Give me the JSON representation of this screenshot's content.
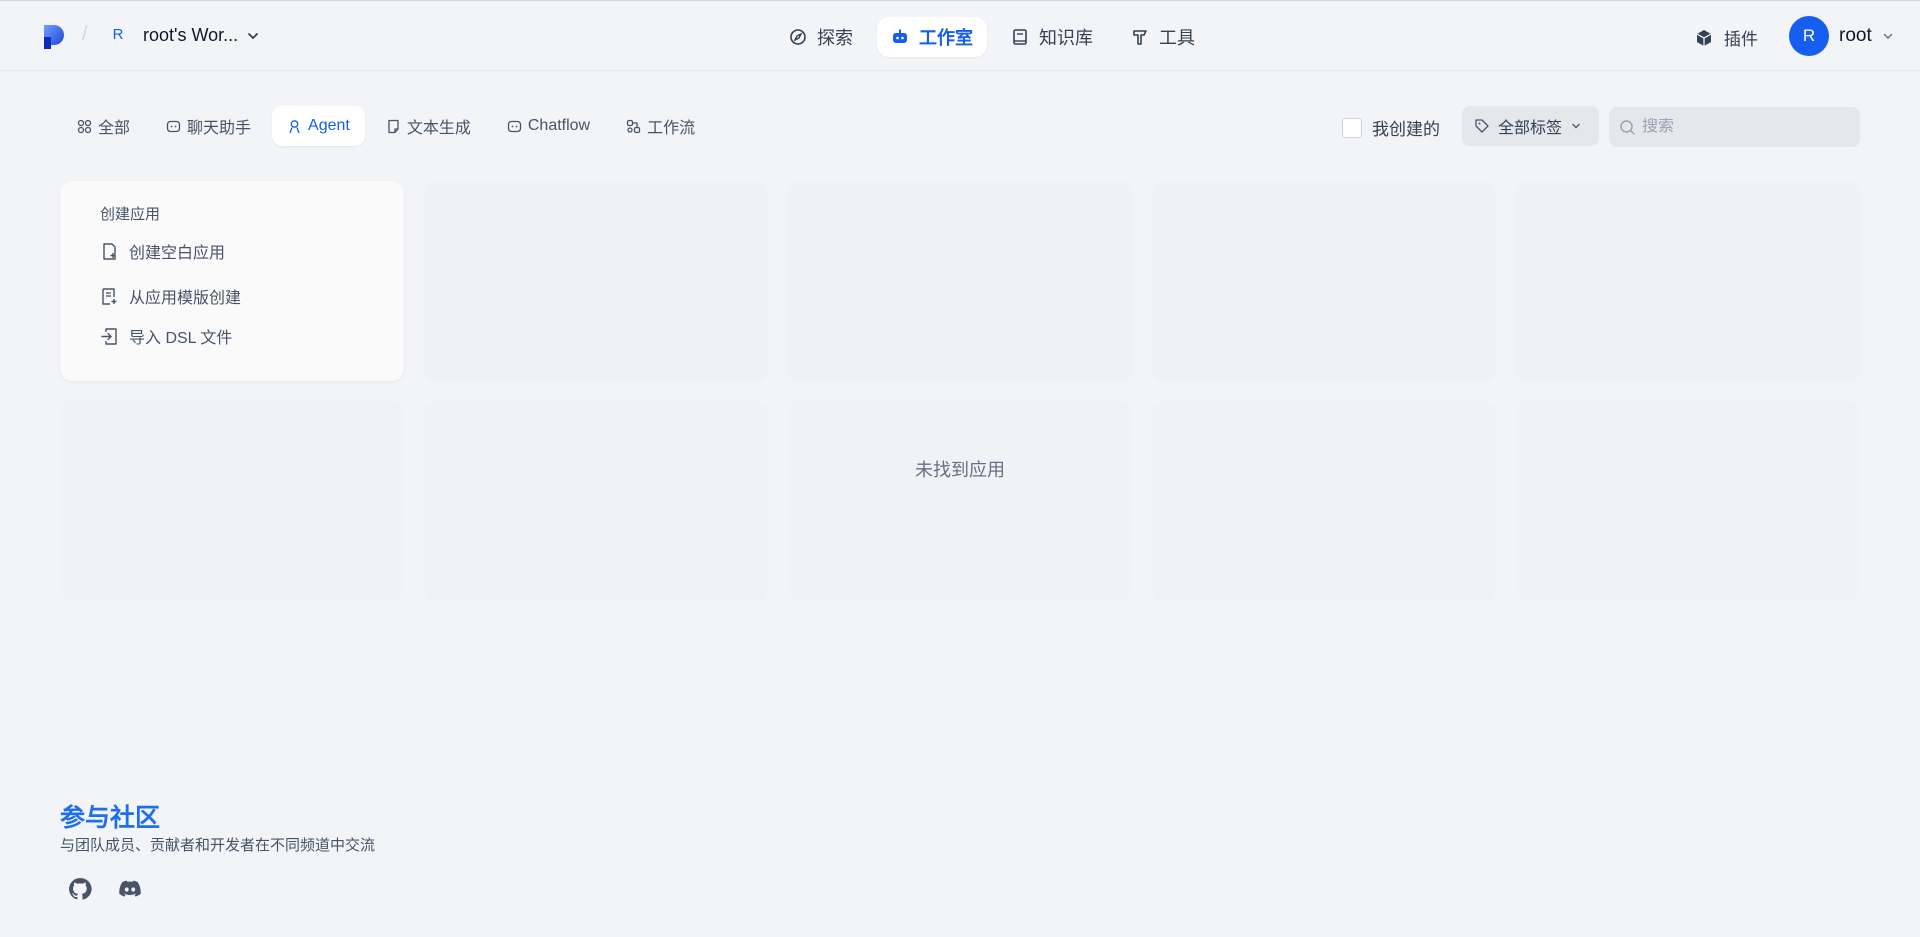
{
  "header": {
    "workspace_initial": "R",
    "workspace_name": "root's Wor...",
    "separator": "/",
    "nav": [
      {
        "label": "探索",
        "icon": "compass-icon"
      },
      {
        "label": "工作室",
        "icon": "robot-icon",
        "active": true
      },
      {
        "label": "知识库",
        "icon": "book-icon"
      },
      {
        "label": "工具",
        "icon": "hammer-icon"
      }
    ],
    "plugin_label": "插件",
    "user_initial": "R",
    "user_name": "root"
  },
  "tabs": [
    {
      "label": "全部",
      "icon": "grid-icon"
    },
    {
      "label": "聊天助手",
      "icon": "chat-bot-icon"
    },
    {
      "label": "Agent",
      "icon": "agent-icon",
      "active": true
    },
    {
      "label": "文本生成",
      "icon": "document-icon"
    },
    {
      "label": "Chatflow",
      "icon": "chatflow-icon"
    },
    {
      "label": "工作流",
      "icon": "workflow-icon"
    }
  ],
  "filters": {
    "mine_label": "我创建的",
    "tag_label": "全部标签",
    "search_placeholder": "搜索"
  },
  "create_card": {
    "title": "创建应用",
    "items": [
      {
        "label": "创建空白应用",
        "icon": "file-plus-icon"
      },
      {
        "label": "从应用模版创建",
        "icon": "template-icon"
      },
      {
        "label": "导入 DSL 文件",
        "icon": "import-icon"
      }
    ]
  },
  "empty_text": "未找到应用",
  "community": {
    "title": "参与社区",
    "subtitle": "与团队成员、贡献者和开发者在不同频道中交流"
  },
  "colors": {
    "accent": "#155eef",
    "background": "#f2f4f7",
    "community_title": "#1d6feb"
  }
}
